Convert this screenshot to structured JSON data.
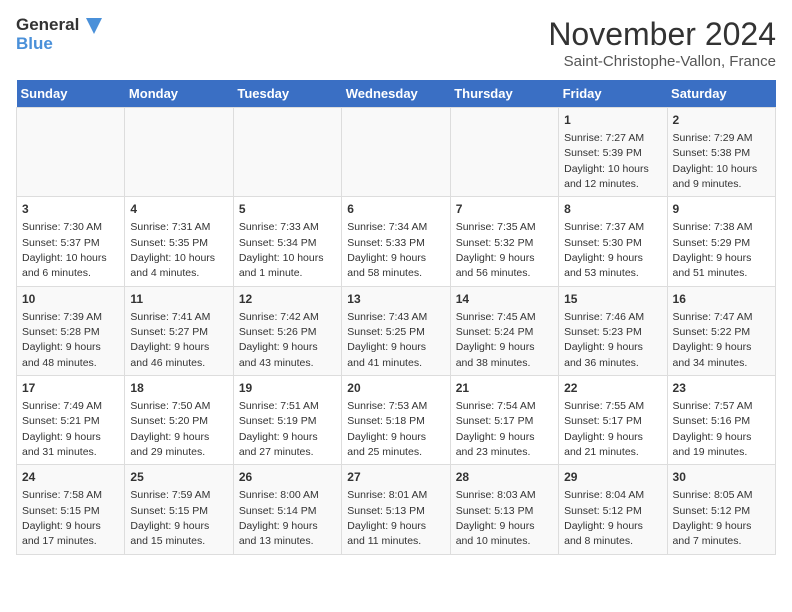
{
  "header": {
    "logo_line1": "General",
    "logo_line2": "Blue",
    "month": "November 2024",
    "location": "Saint-Christophe-Vallon, France"
  },
  "days_of_week": [
    "Sunday",
    "Monday",
    "Tuesday",
    "Wednesday",
    "Thursday",
    "Friday",
    "Saturday"
  ],
  "weeks": [
    [
      {
        "day": "",
        "info": ""
      },
      {
        "day": "",
        "info": ""
      },
      {
        "day": "",
        "info": ""
      },
      {
        "day": "",
        "info": ""
      },
      {
        "day": "",
        "info": ""
      },
      {
        "day": "1",
        "info": "Sunrise: 7:27 AM\nSunset: 5:39 PM\nDaylight: 10 hours and 12 minutes."
      },
      {
        "day": "2",
        "info": "Sunrise: 7:29 AM\nSunset: 5:38 PM\nDaylight: 10 hours and 9 minutes."
      }
    ],
    [
      {
        "day": "3",
        "info": "Sunrise: 7:30 AM\nSunset: 5:37 PM\nDaylight: 10 hours and 6 minutes."
      },
      {
        "day": "4",
        "info": "Sunrise: 7:31 AM\nSunset: 5:35 PM\nDaylight: 10 hours and 4 minutes."
      },
      {
        "day": "5",
        "info": "Sunrise: 7:33 AM\nSunset: 5:34 PM\nDaylight: 10 hours and 1 minute."
      },
      {
        "day": "6",
        "info": "Sunrise: 7:34 AM\nSunset: 5:33 PM\nDaylight: 9 hours and 58 minutes."
      },
      {
        "day": "7",
        "info": "Sunrise: 7:35 AM\nSunset: 5:32 PM\nDaylight: 9 hours and 56 minutes."
      },
      {
        "day": "8",
        "info": "Sunrise: 7:37 AM\nSunset: 5:30 PM\nDaylight: 9 hours and 53 minutes."
      },
      {
        "day": "9",
        "info": "Sunrise: 7:38 AM\nSunset: 5:29 PM\nDaylight: 9 hours and 51 minutes."
      }
    ],
    [
      {
        "day": "10",
        "info": "Sunrise: 7:39 AM\nSunset: 5:28 PM\nDaylight: 9 hours and 48 minutes."
      },
      {
        "day": "11",
        "info": "Sunrise: 7:41 AM\nSunset: 5:27 PM\nDaylight: 9 hours and 46 minutes."
      },
      {
        "day": "12",
        "info": "Sunrise: 7:42 AM\nSunset: 5:26 PM\nDaylight: 9 hours and 43 minutes."
      },
      {
        "day": "13",
        "info": "Sunrise: 7:43 AM\nSunset: 5:25 PM\nDaylight: 9 hours and 41 minutes."
      },
      {
        "day": "14",
        "info": "Sunrise: 7:45 AM\nSunset: 5:24 PM\nDaylight: 9 hours and 38 minutes."
      },
      {
        "day": "15",
        "info": "Sunrise: 7:46 AM\nSunset: 5:23 PM\nDaylight: 9 hours and 36 minutes."
      },
      {
        "day": "16",
        "info": "Sunrise: 7:47 AM\nSunset: 5:22 PM\nDaylight: 9 hours and 34 minutes."
      }
    ],
    [
      {
        "day": "17",
        "info": "Sunrise: 7:49 AM\nSunset: 5:21 PM\nDaylight: 9 hours and 31 minutes."
      },
      {
        "day": "18",
        "info": "Sunrise: 7:50 AM\nSunset: 5:20 PM\nDaylight: 9 hours and 29 minutes."
      },
      {
        "day": "19",
        "info": "Sunrise: 7:51 AM\nSunset: 5:19 PM\nDaylight: 9 hours and 27 minutes."
      },
      {
        "day": "20",
        "info": "Sunrise: 7:53 AM\nSunset: 5:18 PM\nDaylight: 9 hours and 25 minutes."
      },
      {
        "day": "21",
        "info": "Sunrise: 7:54 AM\nSunset: 5:17 PM\nDaylight: 9 hours and 23 minutes."
      },
      {
        "day": "22",
        "info": "Sunrise: 7:55 AM\nSunset: 5:17 PM\nDaylight: 9 hours and 21 minutes."
      },
      {
        "day": "23",
        "info": "Sunrise: 7:57 AM\nSunset: 5:16 PM\nDaylight: 9 hours and 19 minutes."
      }
    ],
    [
      {
        "day": "24",
        "info": "Sunrise: 7:58 AM\nSunset: 5:15 PM\nDaylight: 9 hours and 17 minutes."
      },
      {
        "day": "25",
        "info": "Sunrise: 7:59 AM\nSunset: 5:15 PM\nDaylight: 9 hours and 15 minutes."
      },
      {
        "day": "26",
        "info": "Sunrise: 8:00 AM\nSunset: 5:14 PM\nDaylight: 9 hours and 13 minutes."
      },
      {
        "day": "27",
        "info": "Sunrise: 8:01 AM\nSunset: 5:13 PM\nDaylight: 9 hours and 11 minutes."
      },
      {
        "day": "28",
        "info": "Sunrise: 8:03 AM\nSunset: 5:13 PM\nDaylight: 9 hours and 10 minutes."
      },
      {
        "day": "29",
        "info": "Sunrise: 8:04 AM\nSunset: 5:12 PM\nDaylight: 9 hours and 8 minutes."
      },
      {
        "day": "30",
        "info": "Sunrise: 8:05 AM\nSunset: 5:12 PM\nDaylight: 9 hours and 7 minutes."
      }
    ]
  ]
}
